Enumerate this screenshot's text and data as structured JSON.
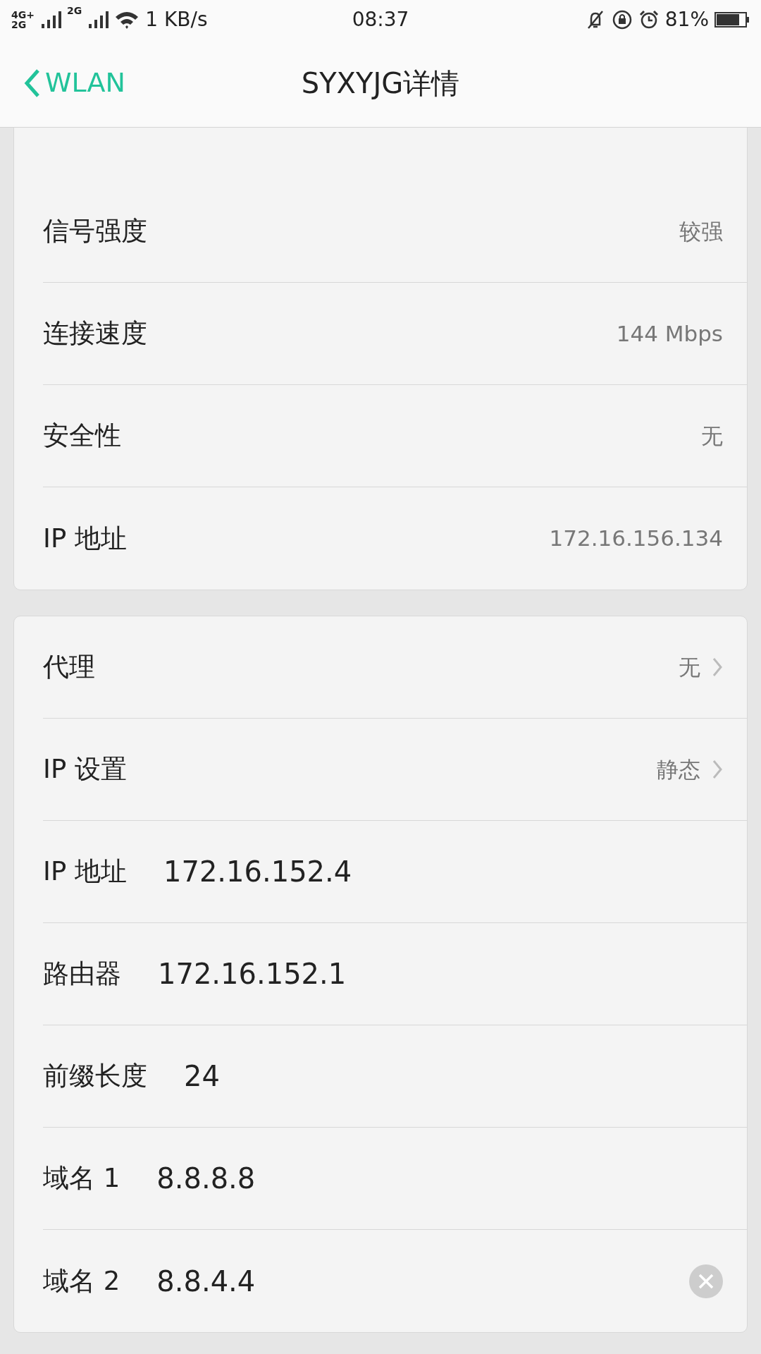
{
  "status_bar": {
    "network_labels": [
      "4G+",
      "2G",
      "2G"
    ],
    "speed": "1 KB/s",
    "time": "08:37",
    "battery_text": "81%"
  },
  "header": {
    "back_label": "WLAN",
    "title": "SYXYJG详情"
  },
  "status_section": {
    "rows": [
      {
        "label": "信号强度",
        "value": "较强"
      },
      {
        "label": "连接速度",
        "value": "144 Mbps"
      },
      {
        "label": "安全性",
        "value": "无"
      },
      {
        "label": "IP 地址",
        "value": "172.16.156.134"
      }
    ]
  },
  "ip_section": {
    "rows": [
      {
        "kind": "link",
        "label": "代理",
        "value": "无"
      },
      {
        "kind": "link",
        "label": "IP 设置",
        "value": "静态"
      },
      {
        "kind": "field",
        "label": "IP 地址",
        "value": "172.16.152.4",
        "focused": false
      },
      {
        "kind": "field",
        "label": "路由器",
        "value": "172.16.152.1",
        "focused": false
      },
      {
        "kind": "field",
        "label": "前缀长度",
        "value": "24",
        "focused": false
      },
      {
        "kind": "field",
        "label": "域名 1",
        "value": "8.8.8.8",
        "focused": false
      },
      {
        "kind": "field",
        "label": "域名 2",
        "value": "8.8.4.4",
        "focused": true
      }
    ]
  }
}
